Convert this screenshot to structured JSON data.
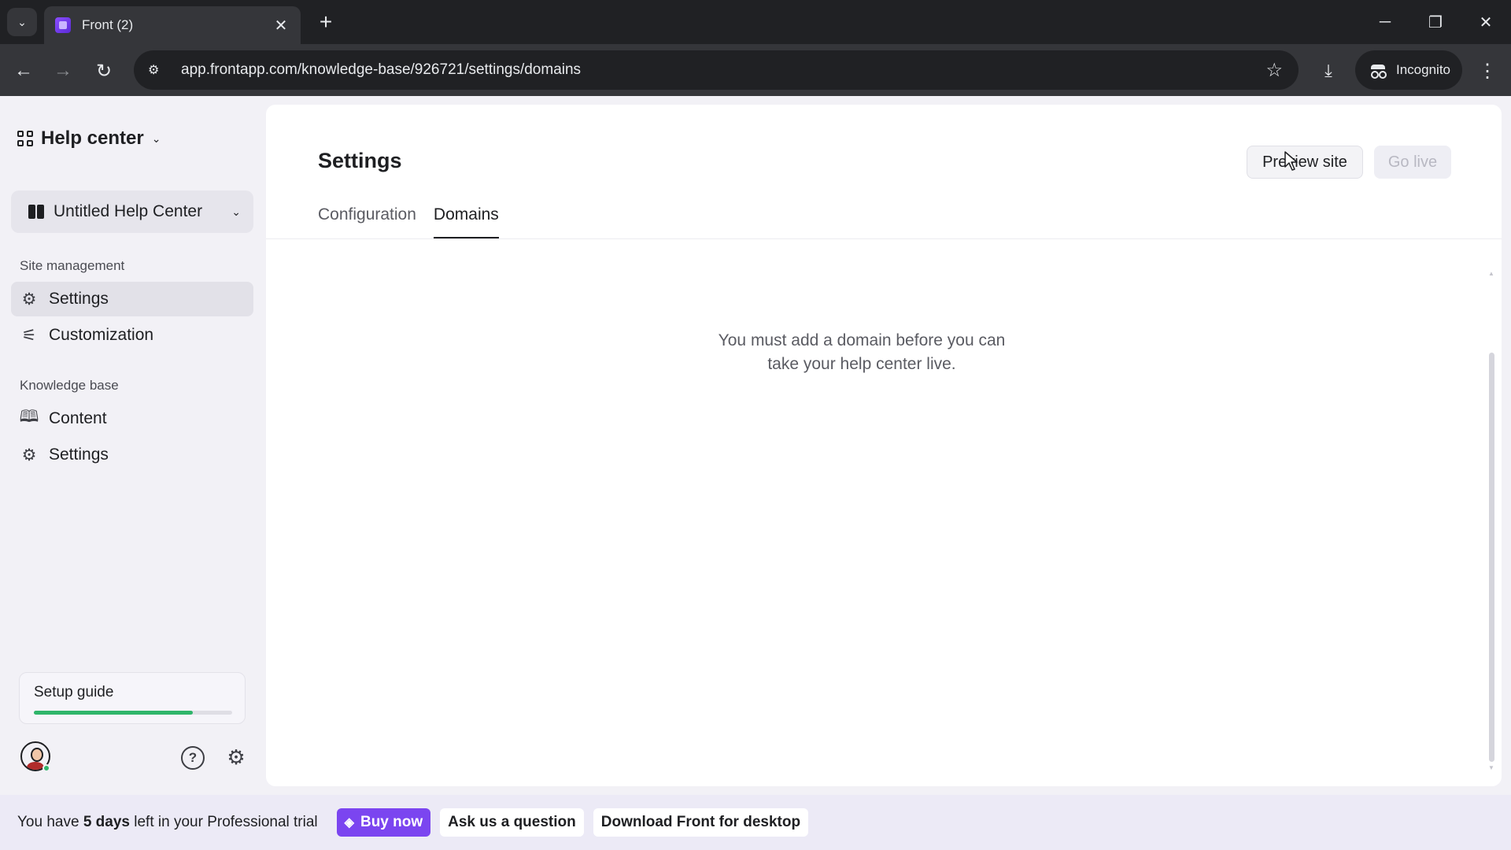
{
  "browser": {
    "tab_title": "Front (2)",
    "url": "app.frontapp.com/knowledge-base/926721/settings/domains",
    "profile_label": "Incognito"
  },
  "sidebar": {
    "header_title": "Help center",
    "selected_help_center": "Untitled Help Center",
    "sections": [
      {
        "label": "Site management",
        "items": [
          {
            "label": "Settings",
            "icon": "gear-icon",
            "active": true
          },
          {
            "label": "Customization",
            "icon": "sliders-icon",
            "active": false
          }
        ]
      },
      {
        "label": "Knowledge base",
        "items": [
          {
            "label": "Content",
            "icon": "book-open-icon",
            "active": false
          },
          {
            "label": "Settings",
            "icon": "gear-icon",
            "active": false
          }
        ]
      }
    ],
    "setup_guide": {
      "label": "Setup guide",
      "progress_percent": 80
    }
  },
  "main": {
    "title": "Settings",
    "preview_label": "Preview site",
    "golive_label": "Go live",
    "tabs": [
      {
        "label": "Configuration",
        "active": false
      },
      {
        "label": "Domains",
        "active": true
      }
    ],
    "empty_message": "You must add a domain before you can take your help center live."
  },
  "trial": {
    "text_before": "You have ",
    "days": "5 days",
    "text_after": " left in your Professional trial",
    "buy_label": "Buy now",
    "ask_label": "Ask us a question",
    "download_label": "Download Front for desktop"
  },
  "colors": {
    "accent": "#7b45f0",
    "progress": "#2fb56a"
  }
}
